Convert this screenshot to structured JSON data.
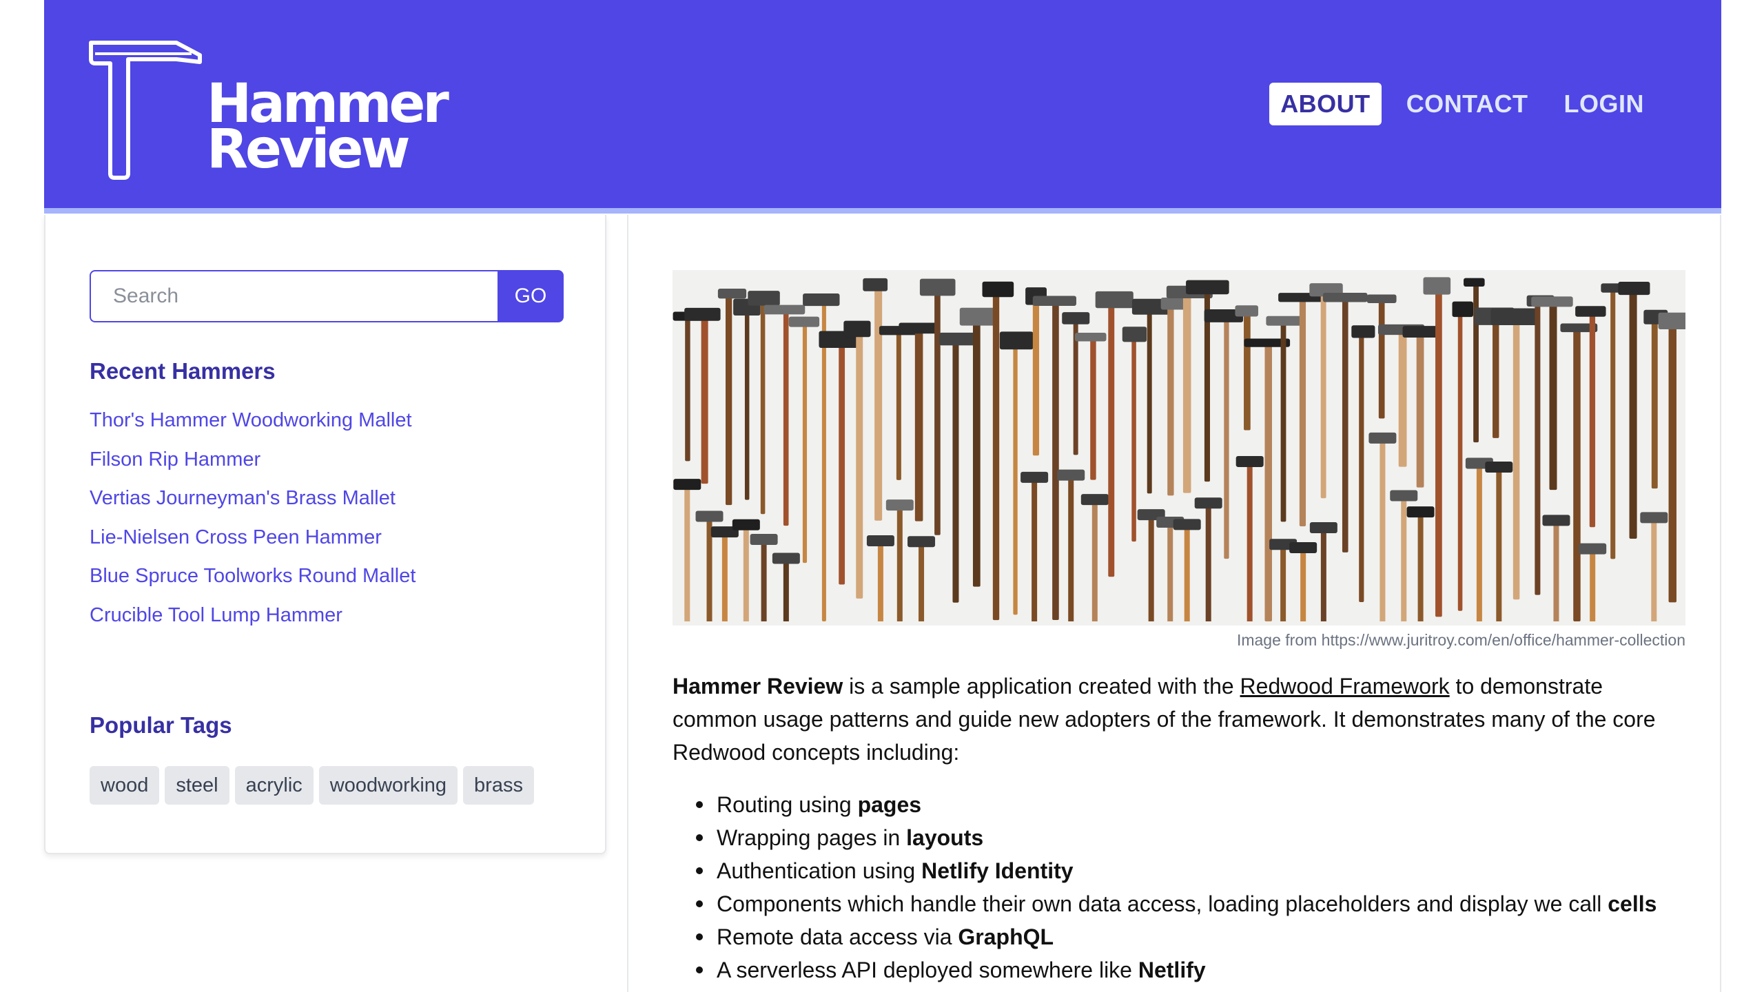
{
  "brand": {
    "line1": "Hammer",
    "line2": "Review",
    "header_color": "#4f46e5"
  },
  "nav": {
    "items": [
      {
        "label": "ABOUT",
        "active": true
      },
      {
        "label": "CONTACT",
        "active": false
      },
      {
        "label": "LOGIN",
        "active": false
      }
    ]
  },
  "search": {
    "placeholder": "Search",
    "value": "",
    "button_label": "GO"
  },
  "recent": {
    "title": "Recent Hammers",
    "items": [
      "Thor's Hammer Woodworking Mallet",
      "Filson Rip Hammer",
      "Vertias Journeyman's Brass Mallet",
      "Lie-Nielsen Cross Peen Hammer",
      "Blue Spruce Toolworks Round Mallet",
      "Crucible Tool Lump Hammer"
    ]
  },
  "tags": {
    "title": "Popular Tags",
    "items": [
      "wood",
      "steel",
      "acrylic",
      "woodworking",
      "brass"
    ]
  },
  "hero": {
    "caption": "Image from https://www.juritroy.com/en/office/hammer-collection"
  },
  "intro": {
    "strong": "Hammer Review",
    "text1": " is a sample application created with the ",
    "link": "Redwood Framework",
    "text2": " to demonstrate common usage patterns and guide new adopters of the framework. It demonstrates many of the core Redwood concepts including:"
  },
  "features": [
    {
      "text": "Routing using ",
      "bold": "pages"
    },
    {
      "text": "Wrapping pages in ",
      "bold": "layouts"
    },
    {
      "text": "Authentication using ",
      "bold": "Netlify Identity"
    },
    {
      "text": "Components which handle their own data access, loading placeholders and display we call ",
      "bold": "cells"
    },
    {
      "text": "Remote data access via ",
      "bold": "GraphQL"
    },
    {
      "text": "A serverless API deployed somewhere like ",
      "bold": "Netlify"
    }
  ]
}
